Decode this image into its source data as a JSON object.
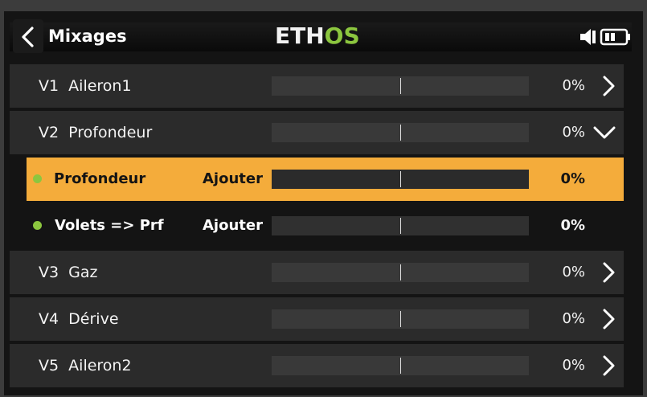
{
  "header": {
    "title": "Mixages",
    "logo_main": "ETH",
    "logo_accent": "OS",
    "logo_color": "#f2f2f2",
    "logo_accent_color": "#8cc63f",
    "icons": [
      "back-icon",
      "speaker-mute-icon",
      "battery-icon"
    ]
  },
  "mixes": [
    {
      "label": "V1  Aileron1",
      "value": "0%",
      "expanded": false
    },
    {
      "label": "V2  Profondeur",
      "value": "0%",
      "expanded": true,
      "children": [
        {
          "label": "Profondeur",
          "operation": "Ajouter",
          "value": "0%",
          "selected": true
        },
        {
          "label": "Volets => Prf",
          "operation": "Ajouter",
          "value": "0%",
          "selected": false
        }
      ]
    },
    {
      "label": "V3  Gaz",
      "value": "0%",
      "expanded": false
    },
    {
      "label": "V4  Dérive",
      "value": "0%",
      "expanded": false
    },
    {
      "label": "V5  Aileron2",
      "value": "0%",
      "expanded": false
    }
  ],
  "colors": {
    "selected_row": "#f4ac3b",
    "status_dot": "#8cc63f",
    "row_bg": "#2b2b2b",
    "background": "#141414"
  }
}
